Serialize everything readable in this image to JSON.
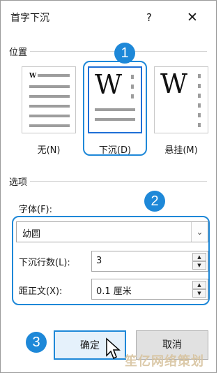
{
  "dialog": {
    "title": "首字下沉",
    "help_label": "?",
    "close_label": "✕"
  },
  "position": {
    "group_label": "位置",
    "options": [
      {
        "label": "无(N)",
        "state": "unselected"
      },
      {
        "label": "下沉(D)",
        "state": "selected"
      },
      {
        "label": "悬挂(M)",
        "state": "unselected"
      }
    ],
    "preview_letter": "W"
  },
  "options": {
    "group_label": "选项",
    "font_label": "字体(F):",
    "font_value": "幼圆",
    "lines_label": "下沉行数(L):",
    "lines_value": "3",
    "distance_label": "距正文(X):",
    "distance_value": "0.1 厘米"
  },
  "buttons": {
    "ok_label": "确定",
    "cancel_label": "取消"
  },
  "callouts": [
    "1",
    "2",
    "3"
  ],
  "watermark": "笙亿网络策划",
  "colors": {
    "accent": "#1e88d8",
    "selection": "#1e6fd6"
  }
}
